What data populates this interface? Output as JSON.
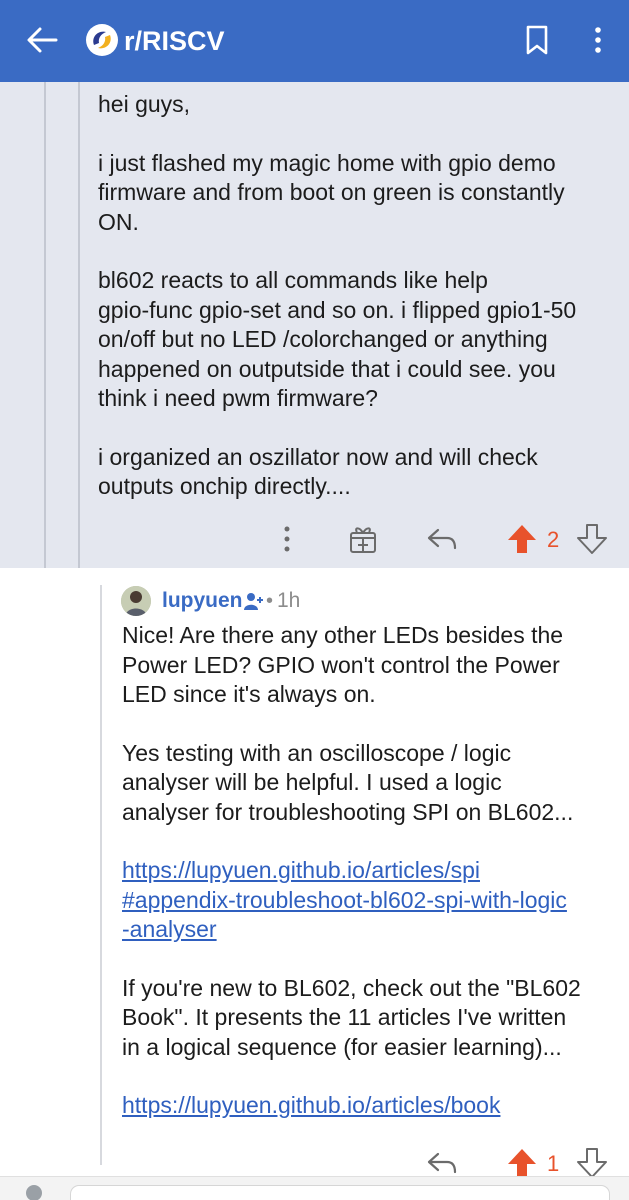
{
  "header": {
    "title": "r/RISCV",
    "icons": [
      "back-arrow-icon",
      "subreddit-logo-icon",
      "bookmark-icon",
      "more-vertical-icon"
    ]
  },
  "parent_comment": {
    "paragraphs": [
      [
        "hei guys,"
      ],
      [
        "i just flashed my magic home with gpio demo",
        "firmware and from boot on green is constantly",
        "ON."
      ],
      [
        "bl602 reacts to all commands like help",
        "gpio-func gpio-set and so on. i flipped gpio1-50",
        "on/off but no LED /colorchanged or anything",
        "happened on outputside that i could see. you",
        "think i need pwm firmware?"
      ],
      [
        "i organized an oszillator now and will check",
        "outputs onchip directly...."
      ]
    ],
    "actions": {
      "icons": [
        "more-vertical-icon",
        "award-icon",
        "reply-icon",
        "upvote-icon",
        "downvote-icon"
      ],
      "score": "2"
    }
  },
  "reply": {
    "author": "lupyuen",
    "age": "1h",
    "dot": "•",
    "paragraphs": [
      [
        "Nice! Are there any other LEDs besides the",
        "Power LED? GPIO won't control the Power",
        "LED since it's always on."
      ],
      [
        "Yes testing with an oscilloscope / logic",
        "analyser will be helpful. I used a logic",
        "analyser for troubleshooting SPI on BL602..."
      ]
    ],
    "link1": [
      "https://lupyuen.github.io/articles/spi",
      "#appendix-troubleshoot-bl602-spi-with-logic",
      "-analyser"
    ],
    "paragraph3": [
      "If you're new to BL602, check out the \"BL602",
      "Book\". It presents the 11 articles I've written",
      "in a logical sequence (for easier learning)..."
    ],
    "link2": "https://lupyuen.github.io/articles/book",
    "actions": {
      "icons": [
        "reply-icon",
        "upvote-icon",
        "downvote-icon"
      ],
      "score": "1"
    }
  },
  "colors": {
    "header": "#3a6bc4",
    "highlight": "#e4e7ef",
    "upvote": "#e8522b",
    "link": "#2f5fbf"
  }
}
